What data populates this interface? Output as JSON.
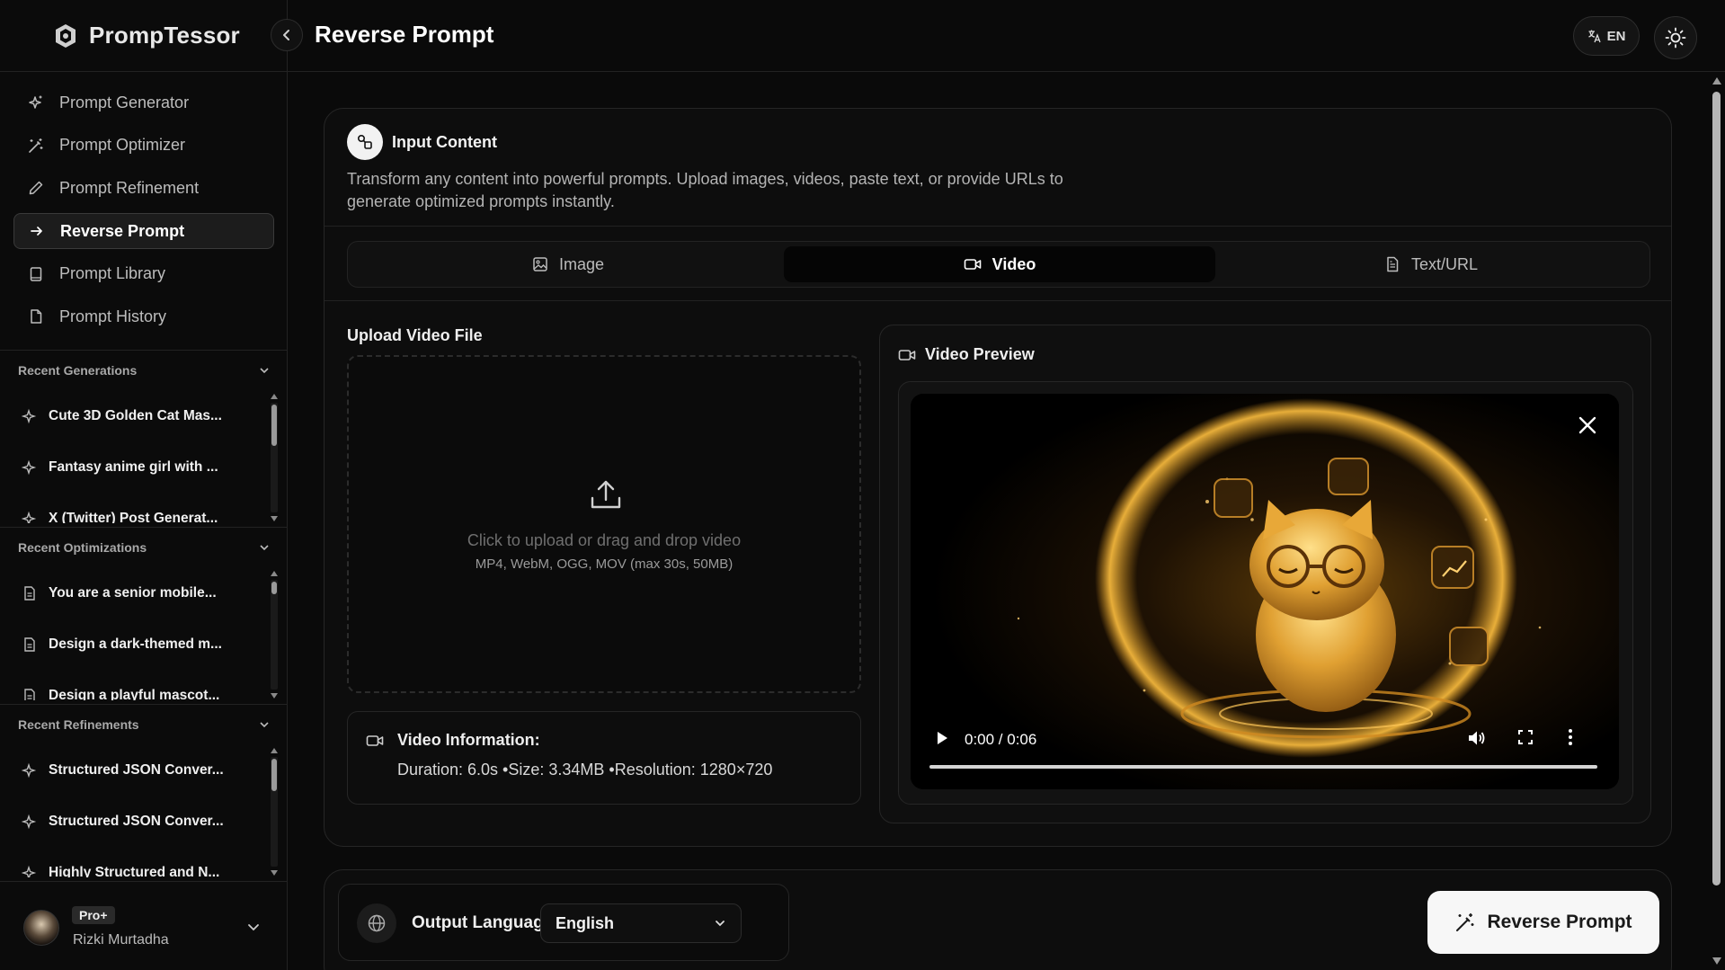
{
  "app": {
    "name": "PrompTessor"
  },
  "header": {
    "title": "Reverse Prompt",
    "language_code": "EN"
  },
  "nav": {
    "items": [
      {
        "label": "Prompt Generator",
        "icon": "sparkle-icon"
      },
      {
        "label": "Prompt Optimizer",
        "icon": "wand-icon"
      },
      {
        "label": "Prompt Refinement",
        "icon": "pencil-icon"
      },
      {
        "label": "Reverse Prompt",
        "icon": "arrow-right-icon",
        "active": true
      },
      {
        "label": "Prompt Library",
        "icon": "book-icon"
      },
      {
        "label": "Prompt History",
        "icon": "file-icon"
      }
    ]
  },
  "sections": {
    "generations": {
      "title": "Recent Generations",
      "items": [
        "Cute 3D Golden Cat Mas...",
        "Fantasy anime girl with ...",
        "X (Twitter) Post Generat..."
      ]
    },
    "optimizations": {
      "title": "Recent Optimizations",
      "items": [
        "You are a senior mobile...",
        "Design a dark-themed m...",
        "Design a playful mascot..."
      ]
    },
    "refinements": {
      "title": "Recent Refinements",
      "items": [
        "Structured JSON Conver...",
        "Structured JSON Conver...",
        "Highly Structured and N..."
      ]
    }
  },
  "user": {
    "plan": "Pro+",
    "name": "Rizki Murtadha"
  },
  "input": {
    "title": "Input Content",
    "description": "Transform any content into powerful prompts. Upload images, videos, paste text, or provide URLs to generate optimized prompts instantly.",
    "tabs": [
      {
        "label": "Image",
        "icon": "image-icon"
      },
      {
        "label": "Video",
        "icon": "video-icon",
        "active": true
      },
      {
        "label": "Text/URL",
        "icon": "document-icon"
      }
    ]
  },
  "upload": {
    "label": "Upload Video File",
    "prompt": "Click to upload or drag and drop video",
    "formats": "MP4, WebM, OGG, MOV (max 30s, 50MB)"
  },
  "video_info": {
    "title": "Video Information:",
    "details": "Duration: 6.0s •Size: 3.34MB •Resolution: 1280×720"
  },
  "preview": {
    "title": "Video Preview",
    "time": "0:00 / 0:06",
    "progress": 0.0
  },
  "output": {
    "label": "Output Language",
    "selected": "English",
    "button": "Reverse Prompt"
  },
  "colors": {
    "background": "#0a0a0a",
    "accent": "#f7f7f7",
    "glow": "#e8a020"
  }
}
